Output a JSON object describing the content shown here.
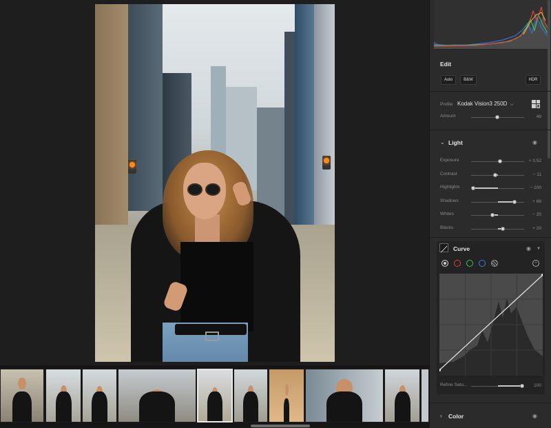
{
  "edit": {
    "title": "Edit",
    "auto_label": "Auto",
    "bw_label": "B&W",
    "hdr_label": "HDR"
  },
  "profile": {
    "label": "Profile",
    "name": "Kodak Vision3 250D",
    "amount_label": "Amount",
    "amount_value": "49",
    "amount_level": 0.49
  },
  "light": {
    "title": "Light",
    "sliders": [
      {
        "label": "Exposure",
        "value": "+ 0.52",
        "level": 0.55
      },
      {
        "label": "Contrast",
        "value": "− 11",
        "level": 0.45
      },
      {
        "label": "Highlights",
        "value": "− 100",
        "level": 0.0
      },
      {
        "label": "Shadows",
        "value": "+ 68",
        "level": 0.84
      },
      {
        "label": "Whites",
        "value": "− 20",
        "level": 0.4
      },
      {
        "label": "Blacks",
        "value": "+ 20",
        "level": 0.6
      }
    ]
  },
  "curve": {
    "title": "Curve",
    "refine_label": "Refine Satu...",
    "refine_value": "100",
    "refine_level": 1.0,
    "channels": [
      {
        "name": "point",
        "color": "#cfcfcf"
      },
      {
        "name": "red",
        "color": "#e0403a"
      },
      {
        "name": "green",
        "color": "#38c05a"
      },
      {
        "name": "blue",
        "color": "#3a7be0"
      },
      {
        "name": "parametric",
        "color": "#9a9a9a"
      }
    ]
  },
  "color": {
    "title": "Color"
  },
  "icons": {
    "eye": "eye-icon",
    "chevron": "chevron-down-icon",
    "preset_grid": "preset-browser-icon",
    "target": "target-adjustment-icon"
  },
  "colors": {
    "panel_bg": "#2b2b2b",
    "canvas_bg": "#1e1e1e",
    "accent": "#d8d8d8"
  }
}
